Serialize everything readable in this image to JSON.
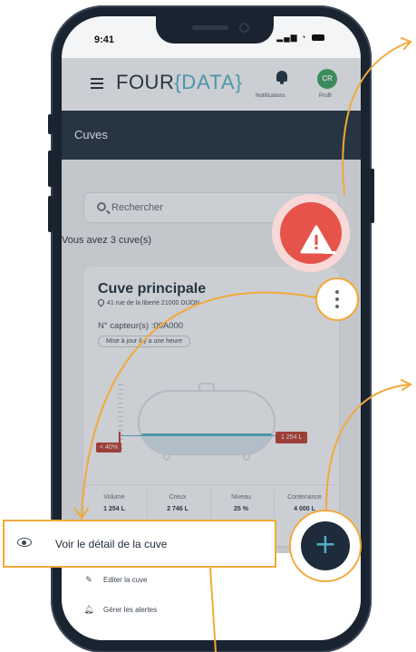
{
  "status_bar": {
    "time": "9:41",
    "signal_icon": "signal-bars-icon",
    "wifi_icon": "wifi-icon",
    "battery_icon": "battery-icon"
  },
  "header": {
    "logo": {
      "part1": "FOUR",
      "brace_open": "{",
      "part2": "DATA",
      "brace_close": "}"
    },
    "notifications_label": "Notifications",
    "profile_initials": "CR",
    "profile_label": "Profil"
  },
  "page_title": "Cuves",
  "search": {
    "placeholder": "Rechercher"
  },
  "tank_count": "Vous avez 3 cuve(s)",
  "tank_card": {
    "name": "Cuve principale",
    "address": "41 rue de la liberté 21000 DIJON",
    "sensor": "N° capteur(s) :00A000",
    "update": "Mise à jour il y a une heure",
    "gauge_label": "< 40%",
    "gauge_level": 0.3,
    "volume_badge": "1 254 L",
    "stats": [
      {
        "label": "Volume",
        "value": "1 254 L"
      },
      {
        "label": "Creux",
        "value": "2 746 L"
      },
      {
        "label": "Niveau",
        "value": "25 %"
      },
      {
        "label": "Contenance",
        "value": "4 000 L"
      }
    ]
  },
  "menu": {
    "view_detail": "Voir le détail de la cuve",
    "edit": "Editer la cuve",
    "alerts": "Gérer les alertes"
  },
  "buttons": {
    "add": "+"
  },
  "colors": {
    "navy": "#1d2b3a",
    "accent": "#4fb1c9",
    "alert_red": "#e5534b",
    "callout_orange": "#f2a93b",
    "avatar_green": "#3aa35a"
  }
}
